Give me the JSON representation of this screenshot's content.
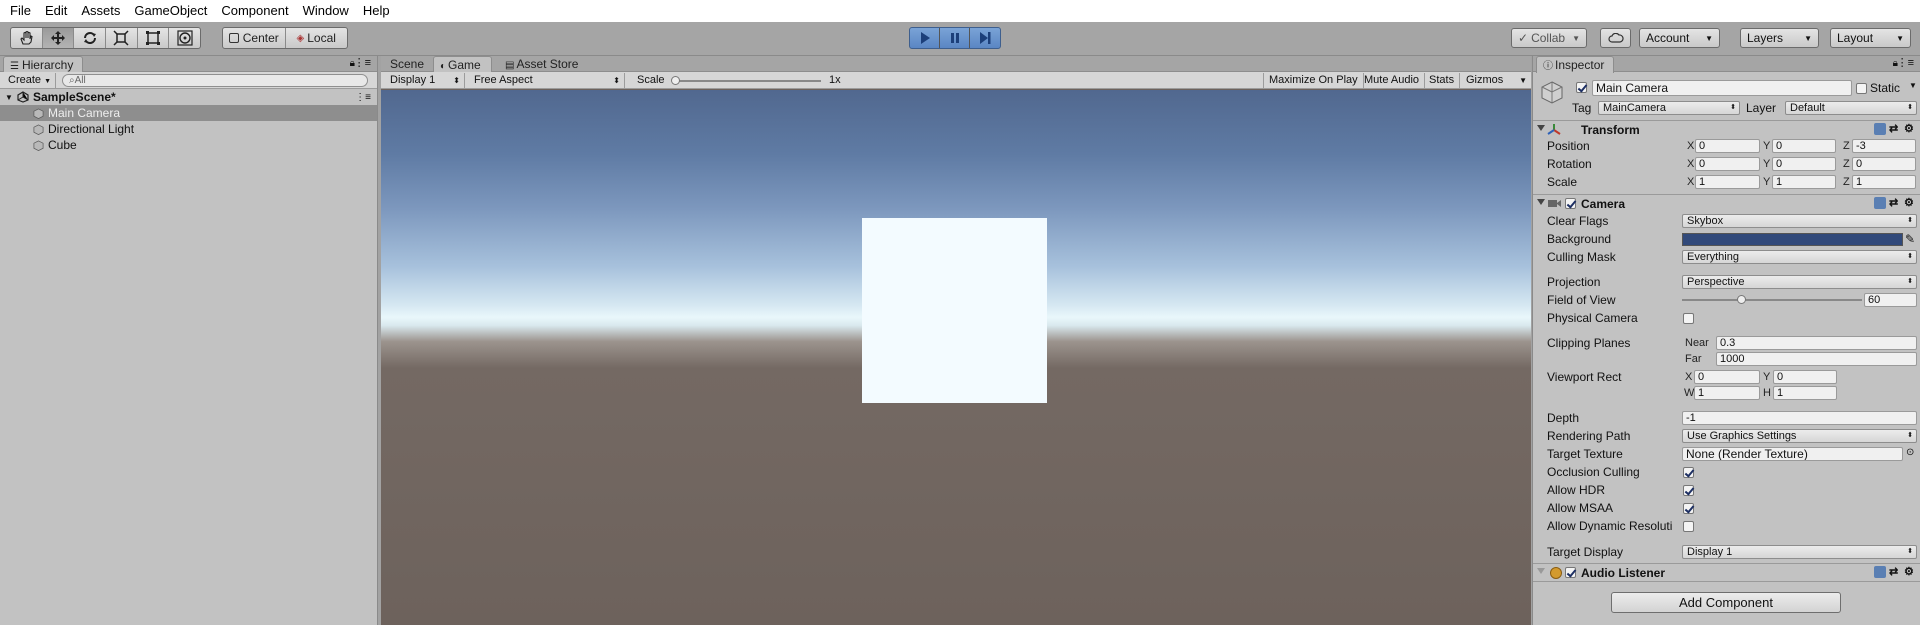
{
  "menu": [
    "File",
    "Edit",
    "Assets",
    "GameObject",
    "Component",
    "Window",
    "Help"
  ],
  "toolbar": {
    "tools": [
      "hand-tool",
      "move-tool",
      "rotate-tool",
      "scale-tool",
      "rect-tool",
      "transform-tool"
    ],
    "active_tool": "move-tool",
    "pivot": "Center",
    "space": "Local",
    "collab": "Collab",
    "account": "Account",
    "layers": "Layers",
    "layout": "Layout"
  },
  "hierarchy": {
    "tab": "Hierarchy",
    "create": "Create",
    "search_placeholder": "All",
    "scene": "SampleScene*",
    "items": [
      {
        "label": "Main Camera",
        "selected": true
      },
      {
        "label": "Directional Light",
        "selected": false
      },
      {
        "label": "Cube",
        "selected": false
      }
    ]
  },
  "game": {
    "tabs": [
      "Scene",
      "Game",
      "Asset Store"
    ],
    "active_tab": "Game",
    "display": "Display 1",
    "aspect": "Free Aspect",
    "scale_label": "Scale",
    "scale_value": "1x",
    "toggles": [
      "Maximize On Play",
      "Mute Audio",
      "Stats",
      "Gizmos"
    ]
  },
  "inspector": {
    "tab": "Inspector",
    "object_name": "Main Camera",
    "static_label": "Static",
    "tag_label": "Tag",
    "tag": "MainCamera",
    "layer_label": "Layer",
    "layer": "Default",
    "transform": {
      "title": "Transform",
      "position": {
        "label": "Position",
        "x": "0",
        "y": "0",
        "z": "-3"
      },
      "rotation": {
        "label": "Rotation",
        "x": "0",
        "y": "0",
        "z": "0"
      },
      "scale": {
        "label": "Scale",
        "x": "1",
        "y": "1",
        "z": "1"
      }
    },
    "camera": {
      "title": "Camera",
      "clear_flags": {
        "label": "Clear Flags",
        "value": "Skybox"
      },
      "background": {
        "label": "Background",
        "color": "#31497a"
      },
      "culling_mask": {
        "label": "Culling Mask",
        "value": "Everything"
      },
      "projection": {
        "label": "Projection",
        "value": "Perspective"
      },
      "fov": {
        "label": "Field of View",
        "value": "60",
        "fraction": 0.33
      },
      "physical": {
        "label": "Physical Camera",
        "checked": false
      },
      "clipping": {
        "label": "Clipping Planes",
        "near_label": "Near",
        "near": "0.3",
        "far_label": "Far",
        "far": "1000"
      },
      "viewport": {
        "label": "Viewport Rect",
        "x": "0",
        "y": "0",
        "w": "1",
        "h": "1"
      },
      "depth": {
        "label": "Depth",
        "value": "-1"
      },
      "rendering_path": {
        "label": "Rendering Path",
        "value": "Use Graphics Settings"
      },
      "target_texture": {
        "label": "Target Texture",
        "value": "None (Render Texture)"
      },
      "occlusion": {
        "label": "Occlusion Culling",
        "checked": true
      },
      "hdr": {
        "label": "Allow HDR",
        "checked": true
      },
      "msaa": {
        "label": "Allow MSAA",
        "checked": true
      },
      "dynres": {
        "label": "Allow Dynamic Resoluti",
        "checked": false
      },
      "target_display": {
        "label": "Target Display",
        "value": "Display 1"
      }
    },
    "audio_listener": {
      "title": "Audio Listener"
    },
    "add_component": "Add Component"
  },
  "colors": {
    "play_accent": "#5a86c4",
    "selection": "#8e8e8e"
  }
}
